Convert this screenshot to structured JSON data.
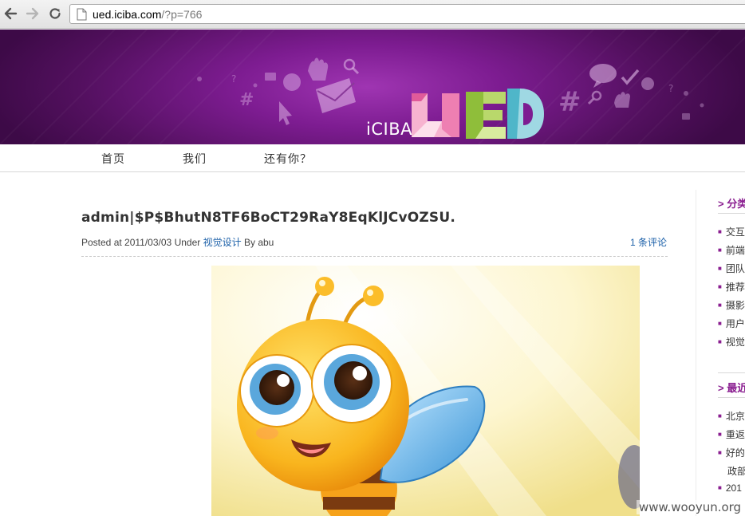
{
  "browser": {
    "url_host": "ued.iciba.com",
    "url_path": "/?p=766",
    "back_icon": "back-arrow-icon",
    "forward_icon": "forward-arrow-icon",
    "reload_icon": "reload-icon"
  },
  "banner": {
    "brand": "iCIBA",
    "logo_letters": "UED"
  },
  "nav": {
    "items": [
      "首页",
      "我们",
      "还有你？"
    ]
  },
  "post": {
    "title": "admin|$P$BhutN8TF6BoCT29RaY8EqKlJCvOZSU.",
    "posted_at_label": "Posted at",
    "date": "2011/03/03",
    "under_label": "Under",
    "category": "视觉设计",
    "by_label": "By",
    "author": "abu",
    "comments": "1 条评论"
  },
  "sidebar": {
    "categories_title": "分类",
    "categories": [
      "交互",
      "前端",
      "团队",
      "推荐",
      "摄影",
      "用户",
      "视觉"
    ],
    "recent_title": "最近",
    "recent": [
      "北京",
      "重返",
      "好的",
      "政部",
      "201"
    ]
  },
  "watermark": "www.wooyun.org",
  "colors": {
    "accent": "#8a1e90",
    "link": "#1a5fa8",
    "banner": "#7d1c91"
  }
}
